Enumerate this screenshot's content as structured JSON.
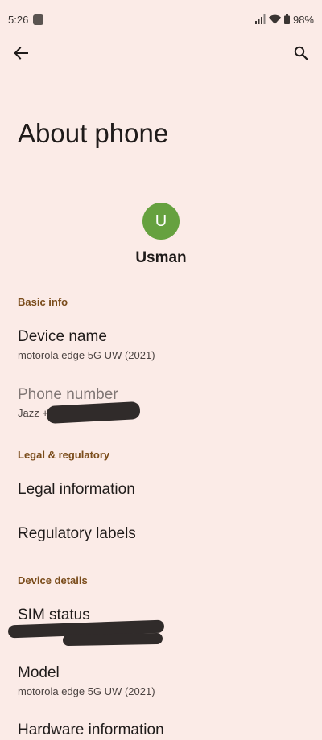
{
  "status_bar": {
    "time": "5:26",
    "battery": "98%",
    "icons": [
      "notification-square-icon",
      "signal-icon",
      "wifi-icon",
      "battery-icon"
    ]
  },
  "app_bar": {
    "icons": [
      "back-arrow-icon",
      "search-icon"
    ]
  },
  "page": {
    "title": "About phone"
  },
  "profile": {
    "avatar_letter": "U",
    "avatar_color": "#66a13f",
    "name": "Usman"
  },
  "sections": {
    "basic_info": "Basic info",
    "legal": "Legal & regulatory",
    "device_details": "Device details"
  },
  "items": {
    "device_name": {
      "title": "Device name",
      "subtitle": "motorola edge 5G UW (2021)"
    },
    "phone_number": {
      "title": "Phone number",
      "subtitle": "Jazz +"
    },
    "legal_information": {
      "title": "Legal information"
    },
    "regulatory_labels": {
      "title": "Regulatory labels"
    },
    "sim_status": {
      "title": "SIM status"
    },
    "model": {
      "title": "Model",
      "subtitle": "motorola edge 5G UW (2021)"
    },
    "hardware_information": {
      "title": "Hardware information"
    }
  },
  "colors": {
    "background": "#fbebe7",
    "section_header": "#7a4c1b",
    "text": "#1f1b1a"
  }
}
